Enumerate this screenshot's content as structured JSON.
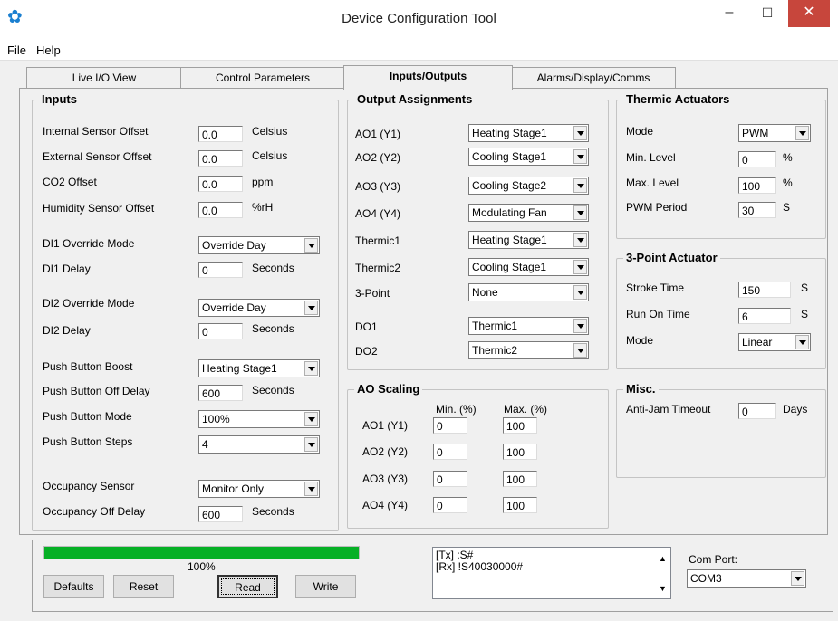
{
  "window": {
    "title": "Device Configuration Tool",
    "minimize": "–",
    "maximize": "☐",
    "close": "✕"
  },
  "menu": [
    "File",
    "Help"
  ],
  "tabs": [
    "Live I/O View",
    "Control Parameters",
    "Inputs/Outputs",
    "Alarms/Display/Comms"
  ],
  "inputs": {
    "title": "Inputs",
    "internal_offset": {
      "label": "Internal Sensor Offset",
      "value": "0.0",
      "unit": "Celsius"
    },
    "external_offset": {
      "label": "External Sensor Offset",
      "value": "0.0",
      "unit": "Celsius"
    },
    "co2_offset": {
      "label": "CO2 Offset",
      "value": "0.0",
      "unit": "ppm"
    },
    "humidity_offset": {
      "label": "Humidity Sensor Offset",
      "value": "0.0",
      "unit": "%rH"
    },
    "di1_mode": {
      "label": "DI1 Override Mode",
      "value": "Override Day"
    },
    "di1_delay": {
      "label": "DI1 Delay",
      "value": "0",
      "unit": "Seconds"
    },
    "di2_mode": {
      "label": "DI2 Override Mode",
      "value": "Override Day"
    },
    "di2_delay": {
      "label": "DI2 Delay",
      "value": "0",
      "unit": "Seconds"
    },
    "pb_boost": {
      "label": "Push Button Boost",
      "value": "Heating Stage1"
    },
    "pb_off_delay": {
      "label": "Push Button Off Delay",
      "value": "600",
      "unit": "Seconds"
    },
    "pb_mode": {
      "label": "Push Button Mode",
      "value": "100%"
    },
    "pb_steps": {
      "label": "Push Button Steps",
      "value": "4"
    },
    "occ_sensor": {
      "label": "Occupancy Sensor",
      "value": "Monitor Only"
    },
    "occ_off_delay": {
      "label": "Occupancy Off Delay",
      "value": "600",
      "unit": "Seconds"
    }
  },
  "outputs": {
    "title": "Output Assignments",
    "rows": [
      {
        "label": "AO1 (Y1)",
        "value": "Heating Stage1"
      },
      {
        "label": "AO2 (Y2)",
        "value": "Cooling Stage1"
      },
      {
        "label": "AO3 (Y3)",
        "value": "Cooling Stage2"
      },
      {
        "label": "AO4 (Y4)",
        "value": "Modulating Fan"
      },
      {
        "label": "Thermic1",
        "value": "Heating Stage1"
      },
      {
        "label": "Thermic2",
        "value": "Cooling Stage1"
      },
      {
        "label": "3-Point",
        "value": "None"
      },
      {
        "label": "DO1",
        "value": "Thermic1"
      },
      {
        "label": "DO2",
        "value": "Thermic2"
      }
    ]
  },
  "ao_scaling": {
    "title": "AO Scaling",
    "min_header": "Min. (%)",
    "max_header": "Max. (%)",
    "rows": [
      {
        "label": "AO1 (Y1)",
        "min": "0",
        "max": "100"
      },
      {
        "label": "AO2 (Y2)",
        "min": "0",
        "max": "100"
      },
      {
        "label": "AO3 (Y3)",
        "min": "0",
        "max": "100"
      },
      {
        "label": "AO4 (Y4)",
        "min": "0",
        "max": "100"
      }
    ]
  },
  "thermic": {
    "title": "Thermic Actuators",
    "mode": {
      "label": "Mode",
      "value": "PWM"
    },
    "min_level": {
      "label": "Min. Level",
      "value": "0",
      "unit": "%"
    },
    "max_level": {
      "label": "Max. Level",
      "value": "100",
      "unit": "%"
    },
    "pwm_period": {
      "label": "PWM Period",
      "value": "30",
      "unit": "S"
    }
  },
  "three_point": {
    "title": "3-Point Actuator",
    "stroke": {
      "label": "Stroke Time",
      "value": "150",
      "unit": "S"
    },
    "run_on": {
      "label": "Run On Time",
      "value": "6",
      "unit": "S"
    },
    "mode": {
      "label": "Mode",
      "value": "Linear"
    }
  },
  "misc": {
    "title": "Misc.",
    "anti_jam": {
      "label": "Anti-Jam Timeout",
      "value": "0",
      "unit": "Days"
    }
  },
  "bottom": {
    "progress": 1.0,
    "progress_label": "100%",
    "buttons": {
      "defaults": "Defaults",
      "reset": "Reset",
      "read": "Read",
      "write": "Write"
    },
    "log": [
      "[Tx] :S#",
      "[Rx] !S40030000#"
    ],
    "com_label": "Com Port:",
    "com_value": "COM3"
  },
  "colors": {
    "progress": "#06b025",
    "close": "#c7463c",
    "gear": "#1a7fd0"
  }
}
